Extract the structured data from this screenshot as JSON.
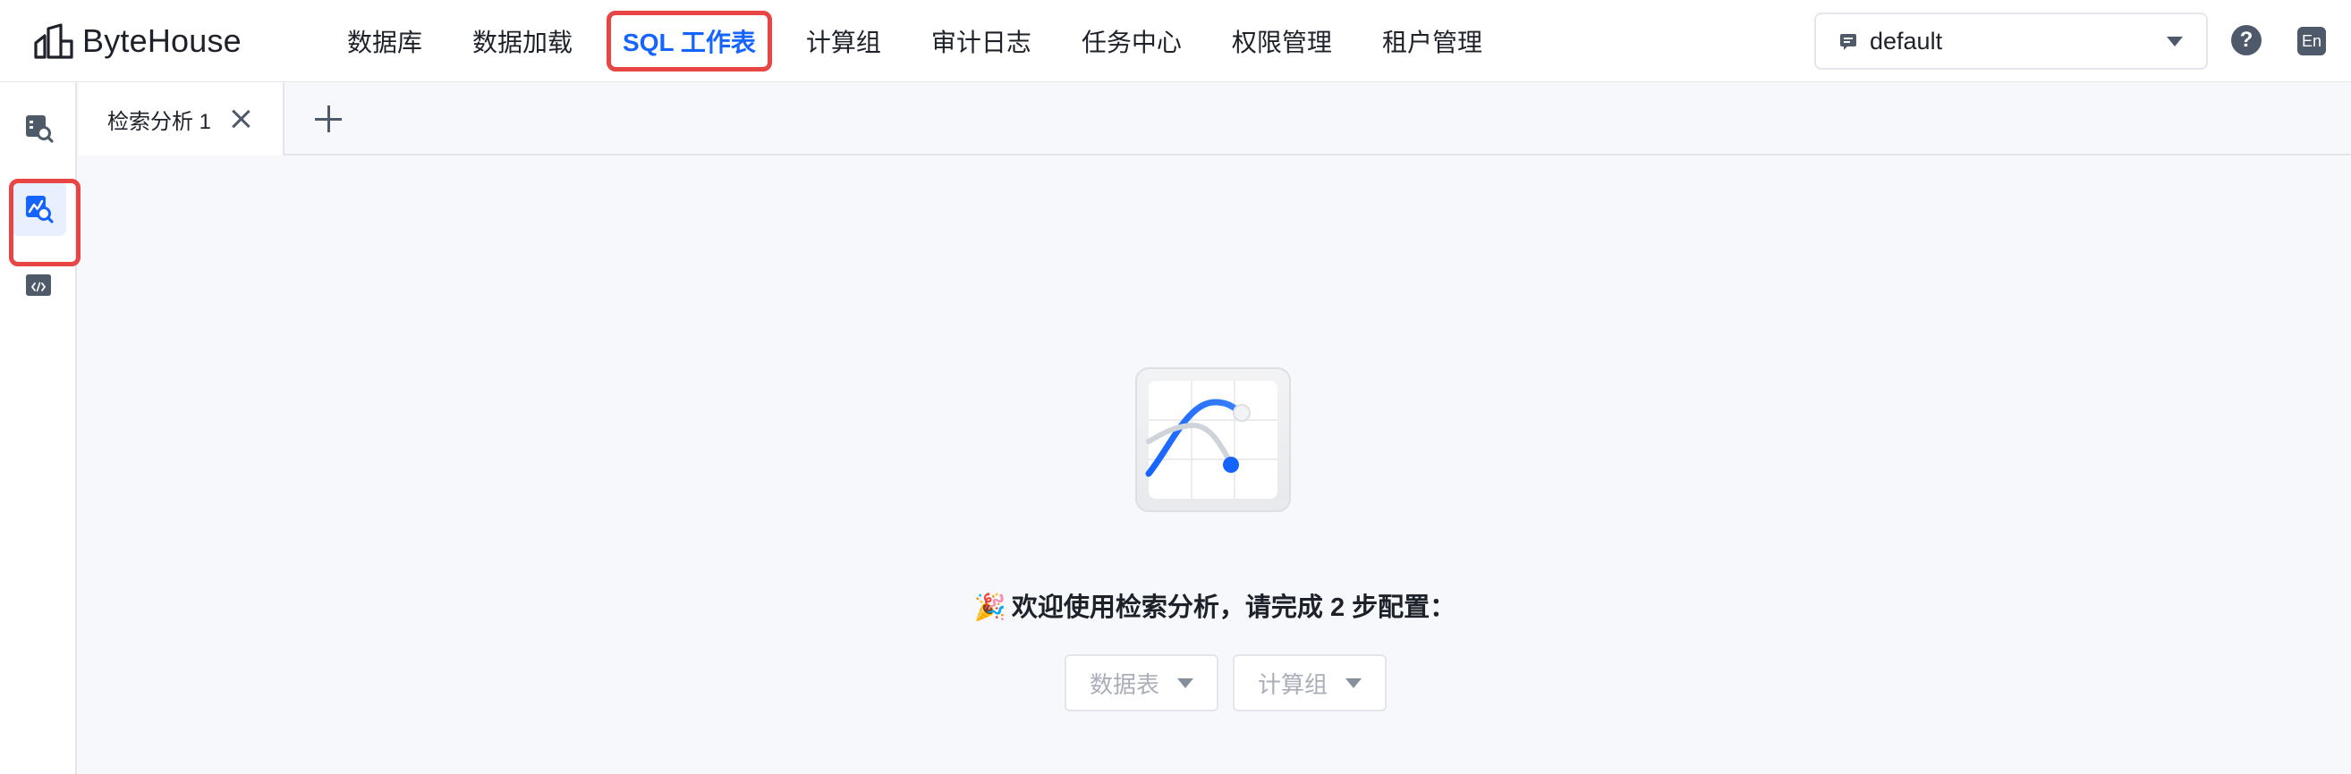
{
  "app": {
    "brand_name": "ByteHouse",
    "accent_color": "#1664ff",
    "highlight_color": "#e84545"
  },
  "nav": {
    "items": [
      {
        "label": "数据库",
        "active": false
      },
      {
        "label": "数据加载",
        "active": false
      },
      {
        "label": "SQL 工作表",
        "active": true
      },
      {
        "label": "计算组",
        "active": false
      },
      {
        "label": "审计日志",
        "active": false
      },
      {
        "label": "任务中心",
        "active": false
      },
      {
        "label": "权限管理",
        "active": false
      },
      {
        "label": "租户管理",
        "active": false
      }
    ]
  },
  "tenant": {
    "icon": "tenant-icon",
    "value": "default"
  },
  "header_actions": {
    "help_label": "?",
    "lang_label": "En"
  },
  "rail": {
    "items": [
      {
        "icon": "sql-query-icon",
        "active": false
      },
      {
        "icon": "search-analysis-icon",
        "active": true
      },
      {
        "icon": "code-window-icon",
        "active": false
      }
    ]
  },
  "tabs": {
    "items": [
      {
        "label": "检索分析 1"
      }
    ],
    "add_icon": "plus-icon"
  },
  "empty_state": {
    "emoji": "🎉",
    "welcome_text": "欢迎使用检索分析，请完成 2 步配置：",
    "selectors": [
      {
        "label": "数据表"
      },
      {
        "label": "计算组"
      }
    ]
  }
}
